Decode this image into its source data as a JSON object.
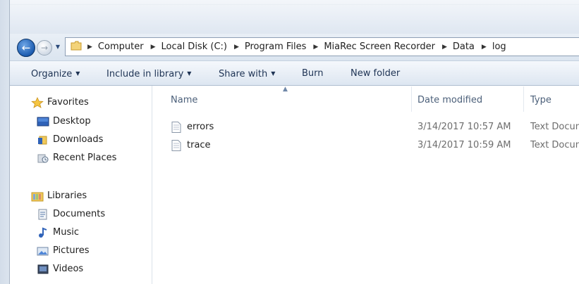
{
  "address": {
    "crumbs": [
      "Computer",
      "Local Disk (C:)",
      "Program Files",
      "MiaRec Screen Recorder",
      "Data",
      "log"
    ]
  },
  "toolbar": {
    "organize": "Organize",
    "include_in_library": "Include in library",
    "share_with": "Share with",
    "burn": "Burn",
    "new_folder": "New folder"
  },
  "nav": {
    "favorites": {
      "label": "Favorites",
      "items": [
        "Desktop",
        "Downloads",
        "Recent Places"
      ]
    },
    "libraries": {
      "label": "Libraries",
      "items": [
        "Documents",
        "Music",
        "Pictures",
        "Videos"
      ]
    }
  },
  "columns": {
    "name": "Name",
    "date_modified": "Date modified",
    "type": "Type"
  },
  "files": [
    {
      "name": "errors",
      "date": "3/14/2017 10:57 AM",
      "type": "Text Document"
    },
    {
      "name": "trace",
      "date": "3/14/2017 10:59 AM",
      "type": "Text Document"
    }
  ],
  "icons": {
    "back": "arrow-left-icon",
    "forward": "arrow-right-icon",
    "favorites": "star-icon",
    "libraries": "library-icon",
    "file": "text-file-icon"
  },
  "colors": {
    "accent": "#1c5cb0",
    "toolbar_text": "#1e3354",
    "header_text": "#4c607a",
    "meta_text": "#6d6d6d"
  }
}
